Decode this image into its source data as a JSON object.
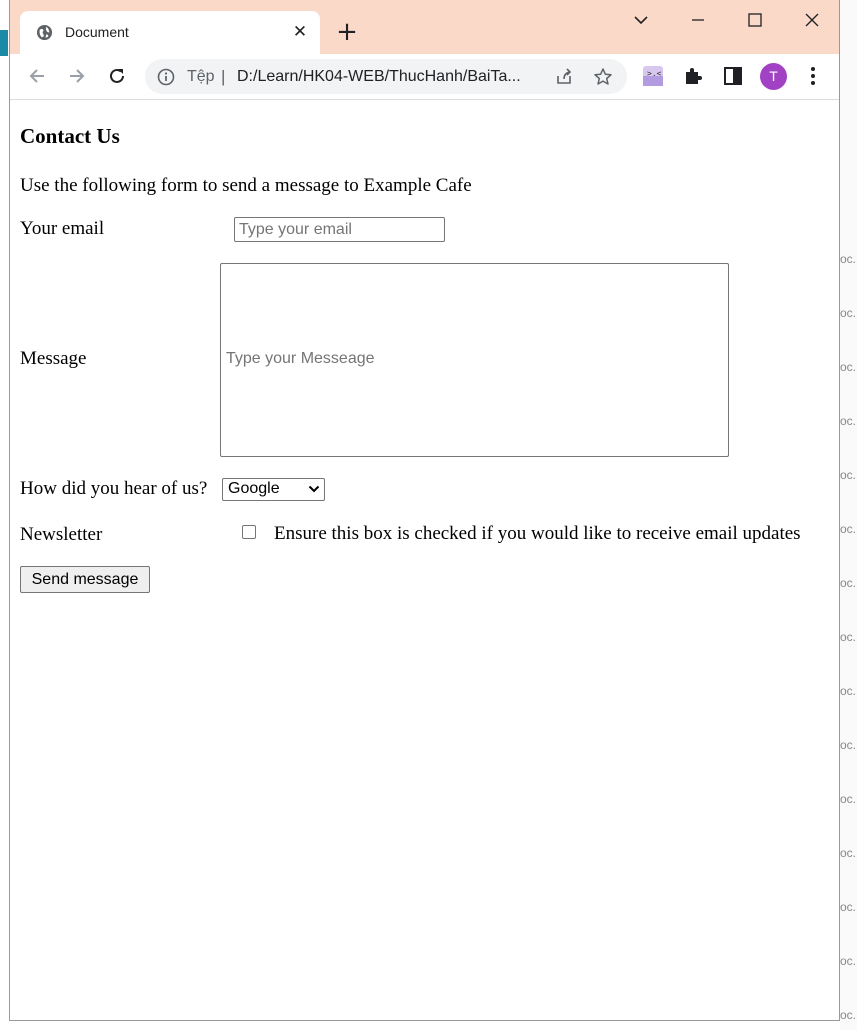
{
  "browser": {
    "tab_title": "Document",
    "tab_close": "✕",
    "new_tab": "+",
    "address_scheme": "Tệp",
    "address_sep": "|",
    "address_url": "D:/Learn/HK04-WEB/ThucHanh/BaiTa...",
    "profile_initial": "T",
    "colors": {
      "titlebar": "#fbd9c8",
      "avatar": "#a142c4"
    }
  },
  "page": {
    "heading": "Contact Us",
    "intro": "Use the following form to send a message to Example Cafe",
    "email_label": "Your email",
    "email_placeholder": "Type your email",
    "message_label": "Message",
    "message_placeholder": "Type your Messeage",
    "hear_label": "How did you hear of us?",
    "hear_selected": "Google",
    "newsletter_label": "Newsletter",
    "newsletter_text": "Ensure this box is checked if you would like to receive email updates",
    "newsletter_checked": false,
    "send_label": "Send message"
  },
  "background_partial": [
    "oc...",
    "oc...",
    "oc...",
    "oc...",
    "oc...",
    "oc...",
    "oc...",
    "oc...",
    "oc...",
    "oc...",
    "oc...",
    "oc...",
    "oc...",
    "oc...",
    "oc..."
  ]
}
